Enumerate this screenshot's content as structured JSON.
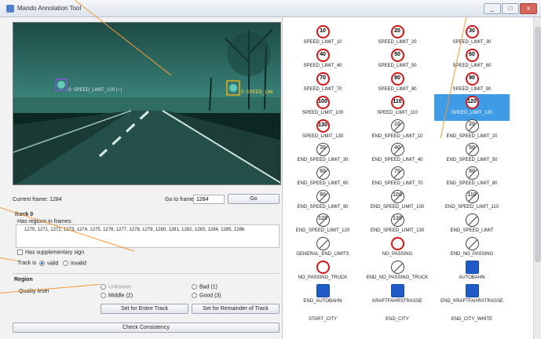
{
  "window": {
    "title": "Mando Annotation Tool",
    "min": "_",
    "max": "□",
    "close": "x"
  },
  "video": {
    "box1_label": "0: SPEED_LIMIT_120 (~)",
    "box2_label": "0: SPEED_LIM"
  },
  "frame": {
    "current_label": "Current frame: 1284",
    "goto_label": "Go to frame",
    "goto_value": "1284",
    "go_button": "Go"
  },
  "track": {
    "title": "Track 0",
    "regions_label": "Has regions in frames:",
    "frames": "1270, 1271, 1272, 1273, 1274, 1275, 1276, 1277, 1278, 1279, 1280, 1281, 1282, 1283, 1284, 1285, 1286",
    "supplementary_label": "Has supplementary sign",
    "track_is_label": "Track is",
    "valid_label": "valid",
    "invalid_label": "invalid"
  },
  "region": {
    "title": "Region",
    "quality_label": "Quality level",
    "options": [
      "Unknown",
      "Bad (1)",
      "Middle (2)",
      "Good (3)"
    ],
    "set_entire_button": "Set for Entire Track",
    "set_remainder_button": "Set for Remainder of Track"
  },
  "check_button": "Check Consistency",
  "signs": [
    {
      "label": "SPEED_LIMIT_10",
      "glyph": "10",
      "kind": "limit"
    },
    {
      "label": "SPEED_LIMIT_20",
      "glyph": "20",
      "kind": "limit"
    },
    {
      "label": "SPEED_LIMIT_30",
      "glyph": "30",
      "kind": "limit"
    },
    {
      "label": "SPEED_LIMIT_40",
      "glyph": "40",
      "kind": "limit"
    },
    {
      "label": "SPEED_LIMIT_50",
      "glyph": "50",
      "kind": "limit"
    },
    {
      "label": "SPEED_LIMIT_60",
      "glyph": "60",
      "kind": "limit"
    },
    {
      "label": "SPEED_LIMIT_70",
      "glyph": "70",
      "kind": "limit"
    },
    {
      "label": "SPEED_LIMIT_80",
      "glyph": "80",
      "kind": "limit"
    },
    {
      "label": "SPEED_LIMIT_90",
      "glyph": "90",
      "kind": "limit"
    },
    {
      "label": "SPEED_LIMIT_100",
      "glyph": "100",
      "kind": "limit"
    },
    {
      "label": "SPEED_LIMIT_110",
      "glyph": "110",
      "kind": "limit"
    },
    {
      "label": "SPEED_LIMIT_120",
      "glyph": "120",
      "kind": "limit",
      "selected": true
    },
    {
      "label": "SPEED_LIMIT_130",
      "glyph": "130",
      "kind": "limit"
    },
    {
      "label": "END_SPEED_LIMIT_10",
      "glyph": "10",
      "kind": "end"
    },
    {
      "label": "END_SPEED_LIMIT_20",
      "glyph": "20",
      "kind": "end"
    },
    {
      "label": "END_SPEED_LIMIT_30",
      "glyph": "30",
      "kind": "end"
    },
    {
      "label": "END_SPEED_LIMIT_40",
      "glyph": "40",
      "kind": "end"
    },
    {
      "label": "END_SPEED_LIMIT_50",
      "glyph": "50",
      "kind": "end"
    },
    {
      "label": "END_SPEED_LIMIT_60",
      "glyph": "60",
      "kind": "end"
    },
    {
      "label": "END_SPEED_LIMIT_70",
      "glyph": "70",
      "kind": "end"
    },
    {
      "label": "END_SPEED_LIMIT_80",
      "glyph": "80",
      "kind": "end"
    },
    {
      "label": "END_SPEED_LIMIT_90",
      "glyph": "90",
      "kind": "end"
    },
    {
      "label": "END_SPEED_LIMIT_100",
      "glyph": "100",
      "kind": "end"
    },
    {
      "label": "END_SPEED_LIMIT_110",
      "glyph": "110",
      "kind": "end"
    },
    {
      "label": "END_SPEED_LIMIT_120",
      "glyph": "120",
      "kind": "end"
    },
    {
      "label": "END_SPEED_LIMIT_130",
      "glyph": "130",
      "kind": "end"
    },
    {
      "label": "END_SPEED_LIMIT",
      "glyph": "",
      "kind": "end"
    },
    {
      "label": "GENERAL_END_LIMITS",
      "glyph": "",
      "kind": "end"
    },
    {
      "label": "NO_PASSING",
      "glyph": "",
      "kind": "limit"
    },
    {
      "label": "END_NO_PASSING",
      "glyph": "",
      "kind": "end"
    },
    {
      "label": "NO_PASSING_TRUCK",
      "glyph": "",
      "kind": "limit"
    },
    {
      "label": "END_NO_PASSING_TRUCK",
      "glyph": "",
      "kind": "end"
    },
    {
      "label": "AUTOBAHN",
      "glyph": "",
      "kind": "blue"
    },
    {
      "label": "END_AUTOBAHN",
      "glyph": "",
      "kind": "blue"
    },
    {
      "label": "KRAFTFAHRSTRASSE",
      "glyph": "",
      "kind": "blue"
    },
    {
      "label": "END_KRAFTFAHRSTRASSE",
      "glyph": "",
      "kind": "blue"
    },
    {
      "label": "START_CITY",
      "glyph": "",
      "kind": "none"
    },
    {
      "label": "END_CITY",
      "glyph": "",
      "kind": "none"
    },
    {
      "label": "END_CITY_WHITE",
      "glyph": "",
      "kind": "none"
    }
  ]
}
